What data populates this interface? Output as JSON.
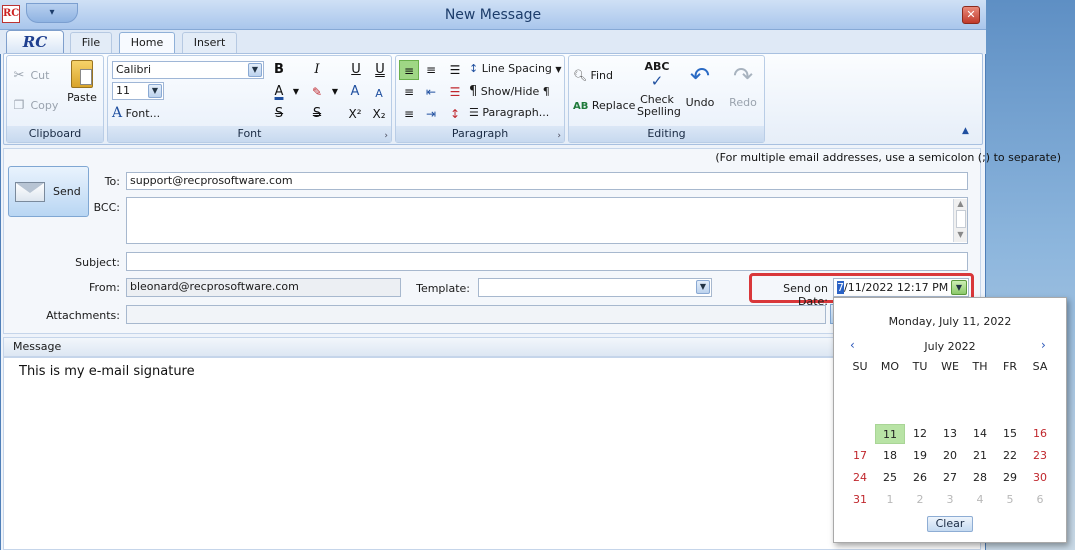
{
  "window": {
    "title": "New Message",
    "app_logo": "RC",
    "qat_glyph": "▾",
    "close_glyph": "✕"
  },
  "tabs": [
    {
      "label": "File"
    },
    {
      "label": "Home"
    },
    {
      "label": "Insert"
    }
  ],
  "ribbon": {
    "clipboard": {
      "label": "Clipboard",
      "cut": "Cut",
      "copy": "Copy",
      "paste": "Paste"
    },
    "font": {
      "label": "Font",
      "family": "Calibri",
      "size": "11",
      "font_dialog": "Font..."
    },
    "paragraph": {
      "label": "Paragraph",
      "line_spacing": "Line Spacing",
      "show_hide": "Show/Hide ¶",
      "paragraph_dialog": "Paragraph..."
    },
    "editing": {
      "label": "Editing",
      "find": "Find",
      "replace": "Replace",
      "check_spelling_1": "Check",
      "check_spelling_2": "Spelling",
      "undo": "Undo",
      "redo": "Redo"
    }
  },
  "compose": {
    "hint": "(For multiple email addresses, use a semicolon (;) to separate)",
    "send_label": "Send",
    "to_label": "To:",
    "to_value": "support@recprosoftware.com",
    "bcc_label": "BCC:",
    "bcc_value": "",
    "subject_label": "Subject:",
    "subject_value": "",
    "from_label": "From:",
    "from_value": "bleonard@recprosoftware.com",
    "template_label": "Template:",
    "template_value": "",
    "send_on_date_label": "Send on Date:",
    "send_on_date_sel": "7",
    "send_on_date_rest": "/11/2022 12:17 PM",
    "attachments_label": "Attachments:",
    "message_label": "Message",
    "message_text": "This is my e-mail signature"
  },
  "calendar": {
    "full_date": "Monday, July 11, 2022",
    "month_year": "July 2022",
    "prev": "‹",
    "next": "›",
    "weekdays": [
      "SU",
      "MO",
      "TU",
      "WE",
      "TH",
      "FR",
      "SA"
    ],
    "weeks": [
      [
        "",
        "",
        "",
        "",
        "",
        "",
        ""
      ],
      [
        "",
        "11",
        "12",
        "13",
        "14",
        "15",
        "16"
      ],
      [
        "17",
        "18",
        "19",
        "20",
        "21",
        "22",
        "23"
      ],
      [
        "24",
        "25",
        "26",
        "27",
        "28",
        "29",
        "30"
      ],
      [
        "31",
        "1",
        "2",
        "3",
        "4",
        "5",
        "6"
      ]
    ],
    "selected_day": "11",
    "clear_label": "Clear"
  },
  "colors": {
    "accent": "#2b63c6",
    "highlight_border": "#d9373a",
    "today_bg": "#b8e3a5",
    "weekend": "#c0272d"
  },
  "icons": [
    "cut-icon",
    "copy-icon",
    "paste-icon",
    "bold-icon",
    "italic-icon",
    "underline-icon",
    "double-underline-icon",
    "font-color-icon",
    "highlight-icon",
    "grow-font-icon",
    "shrink-font-icon",
    "font-dialog-icon",
    "strikethrough-icon",
    "double-strike-icon",
    "superscript-icon",
    "subscript-icon",
    "align-left-icon",
    "align-center-icon",
    "bullets-icon",
    "line-spacing-icon",
    "find-icon",
    "replace-icon",
    "spelling-icon",
    "undo-icon",
    "redo-icon",
    "envelope-icon",
    "calendar-dropdown-icon"
  ]
}
